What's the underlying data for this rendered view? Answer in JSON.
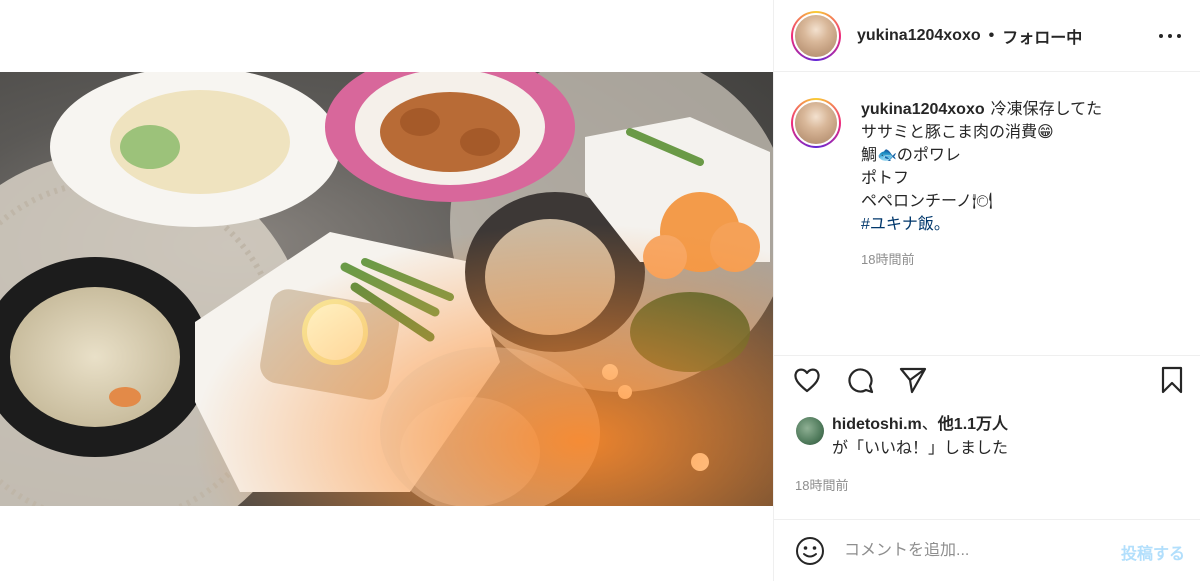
{
  "post": {
    "username": "yukina1204xoxo",
    "separator": "•",
    "follow_status": "フォロー中"
  },
  "caption": {
    "username": "yukina1204xoxo",
    "lines": [
      "冷凍保存してた",
      "ササミと豚こま肉の消費😁",
      "鯛🐟のポワレ",
      "ポトフ",
      "ペペロンチーノ🍽"
    ],
    "hashtag": "#ユキナ飯。",
    "time": "18時間前"
  },
  "likes": {
    "user": "hidetoshi.m",
    "others": "他1.1万人",
    "suffix": "が「いいね！」しました"
  },
  "post_time": "18時間前",
  "comment": {
    "placeholder": "コメントを追加...",
    "post_label": "投稿する"
  },
  "icons": {
    "more": "more-options-icon",
    "like": "heart-icon",
    "comment": "comment-icon",
    "share": "share-icon",
    "save": "bookmark-icon",
    "emoji": "smile-icon"
  },
  "colors": {
    "post_button": "#b2dffc",
    "hashtag": "#00376b",
    "muted": "#8e8e8e"
  }
}
